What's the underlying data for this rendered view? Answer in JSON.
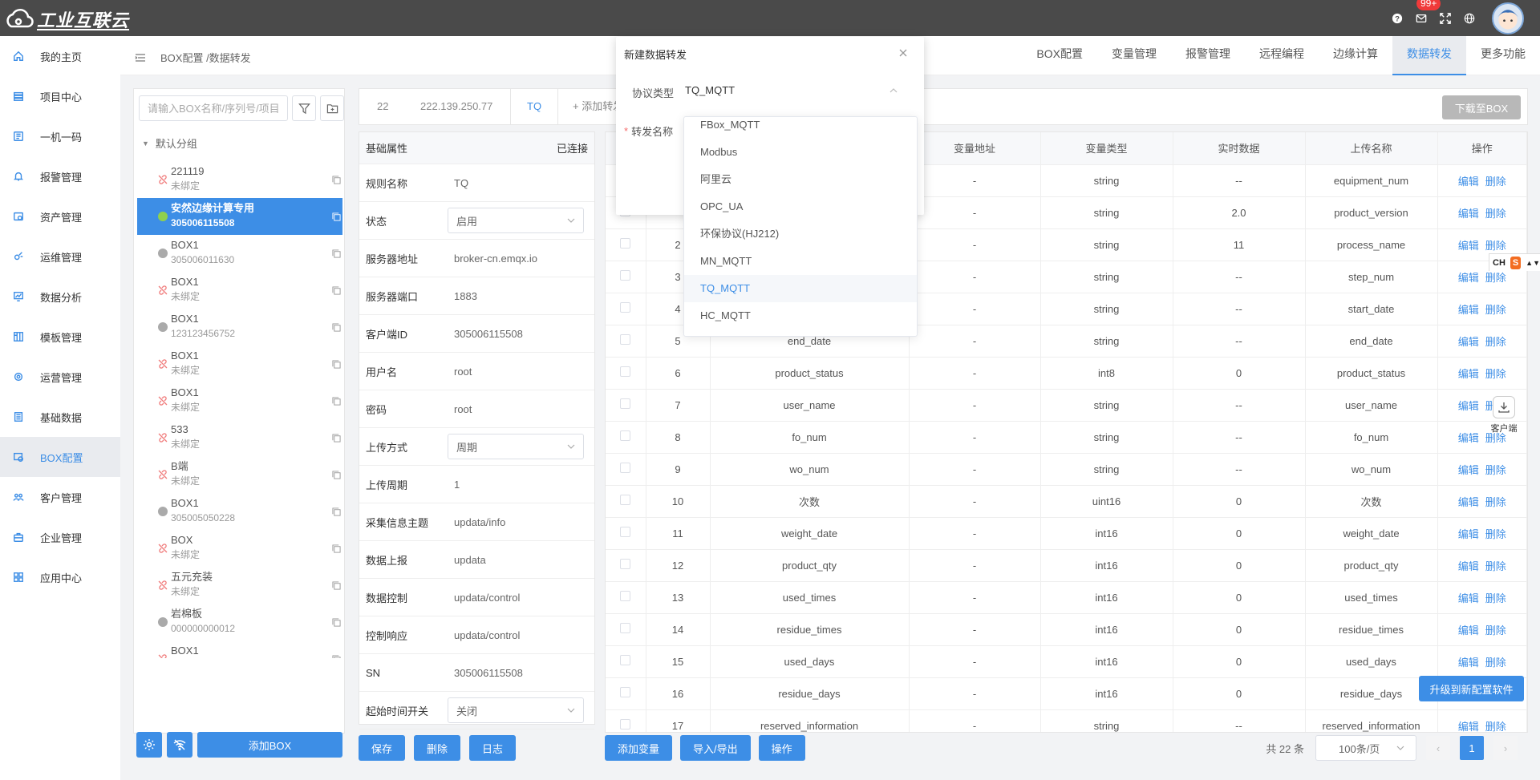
{
  "app": {
    "logo_text": "工业互联云",
    "badge": "99+"
  },
  "sidebar": {
    "items": [
      {
        "label": "我的主页",
        "icon": "home-icon"
      },
      {
        "label": "项目中心",
        "icon": "project-icon"
      },
      {
        "label": "一机一码",
        "icon": "qrcode-icon"
      },
      {
        "label": "报警管理",
        "icon": "bell-icon"
      },
      {
        "label": "资产管理",
        "icon": "asset-icon"
      },
      {
        "label": "运维管理",
        "icon": "tools-icon"
      },
      {
        "label": "数据分析",
        "icon": "chart-icon"
      },
      {
        "label": "模板管理",
        "icon": "template-icon"
      },
      {
        "label": "运营管理",
        "icon": "operate-icon"
      },
      {
        "label": "基础数据",
        "icon": "database-icon"
      },
      {
        "label": "BOX配置",
        "icon": "box-icon"
      },
      {
        "label": "客户管理",
        "icon": "users-icon"
      },
      {
        "label": "企业管理",
        "icon": "briefcase-icon"
      },
      {
        "label": "应用中心",
        "icon": "apps-icon"
      }
    ]
  },
  "header": {
    "breadcrumb": "BOX配置 /数据转发",
    "tabs": [
      "BOX配置",
      "变量管理",
      "报警管理",
      "远程编程",
      "边缘计算",
      "数据转发",
      "更多功能"
    ]
  },
  "boxlist": {
    "search_placeholder": "请输入BOX名称/序列号/项目",
    "group": "默认分组",
    "items": [
      {
        "name": "221119",
        "sub": "未绑定",
        "status": "unlink"
      },
      {
        "name": "安然边缘计算专用",
        "sub": "305006115508",
        "status": "online"
      },
      {
        "name": "BOX1",
        "sub": "305006011630",
        "status": "offline"
      },
      {
        "name": "BOX1",
        "sub": "未绑定",
        "status": "unlink"
      },
      {
        "name": "BOX1",
        "sub": "123123456752",
        "status": "offline"
      },
      {
        "name": "BOX1",
        "sub": "未绑定",
        "status": "unlink"
      },
      {
        "name": "BOX1",
        "sub": "未绑定",
        "status": "unlink"
      },
      {
        "name": "533",
        "sub": "未绑定",
        "status": "unlink"
      },
      {
        "name": "B端",
        "sub": "未绑定",
        "status": "unlink"
      },
      {
        "name": "BOX1",
        "sub": "305005050228",
        "status": "offline"
      },
      {
        "name": "BOX",
        "sub": "未绑定",
        "status": "unlink"
      },
      {
        "name": "五元充装",
        "sub": "未绑定",
        "status": "unlink"
      },
      {
        "name": "岩棉板",
        "sub": "000000000012",
        "status": "offline"
      },
      {
        "name": "BOX1",
        "sub": "未绑定",
        "status": "unlink"
      },
      {
        "name": "BOX1",
        "sub": "未绑定",
        "status": "unlink"
      },
      {
        "name": "BOX1",
        "sub": "",
        "status": "unlink"
      }
    ],
    "add_label": "添加BOX"
  },
  "fwd": {
    "tab_id": "22",
    "tab_ip": "222.139.250.77",
    "tab_active": "TQ",
    "tab_add": "+ 添加转发",
    "download_label": "下载至BOX"
  },
  "props": {
    "head": "基础属性",
    "connected": "已连接",
    "rows": [
      {
        "label": "规则名称",
        "value": "TQ"
      },
      {
        "label": "状态",
        "value": "启用",
        "select": true
      },
      {
        "label": "服务器地址",
        "value": "broker-cn.emqx.io"
      },
      {
        "label": "服务器端口",
        "value": "1883"
      },
      {
        "label": "客户端ID",
        "value": "305006115508"
      },
      {
        "label": "用户名",
        "value": "root"
      },
      {
        "label": "密码",
        "value": "root"
      },
      {
        "label": "上传方式",
        "value": "周期",
        "select": true
      },
      {
        "label": "上传周期",
        "value": "1"
      },
      {
        "label": "采集信息主题",
        "value": "updata/info"
      },
      {
        "label": "数据上报",
        "value": "updata"
      },
      {
        "label": "数据控制",
        "value": "updata/control"
      },
      {
        "label": "控制响应",
        "value": "updata/control"
      },
      {
        "label": "SN",
        "value": "305006115508"
      },
      {
        "label": "起始时间开关",
        "value": "关闭",
        "select": true
      }
    ],
    "save": "保存",
    "delete": "删除",
    "log": "日志"
  },
  "vtable": {
    "headers": [
      "变量地址",
      "变量类型",
      "实时数据",
      "上传名称",
      "操作"
    ],
    "edit": "编辑",
    "del": "删除",
    "rows": [
      {
        "no": "",
        "name": "",
        "addr": "-",
        "type": "string",
        "rt": "--",
        "up": "equipment_num"
      },
      {
        "no": "",
        "name": "",
        "addr": "-",
        "type": "string",
        "rt": "2.0",
        "up": "product_version"
      },
      {
        "no": "2",
        "name": "",
        "addr": "-",
        "type": "string",
        "rt": "11",
        "up": "process_name"
      },
      {
        "no": "3",
        "name": "",
        "addr": "-",
        "type": "string",
        "rt": "--",
        "up": "step_num"
      },
      {
        "no": "4",
        "name": "",
        "addr": "-",
        "type": "string",
        "rt": "--",
        "up": "start_date"
      },
      {
        "no": "5",
        "name": "end_date",
        "addr": "-",
        "type": "string",
        "rt": "--",
        "up": "end_date"
      },
      {
        "no": "6",
        "name": "product_status",
        "addr": "-",
        "type": "int8",
        "rt": "0",
        "up": "product_status"
      },
      {
        "no": "7",
        "name": "user_name",
        "addr": "-",
        "type": "string",
        "rt": "--",
        "up": "user_name"
      },
      {
        "no": "8",
        "name": "fo_num",
        "addr": "-",
        "type": "string",
        "rt": "--",
        "up": "fo_num"
      },
      {
        "no": "9",
        "name": "wo_num",
        "addr": "-",
        "type": "string",
        "rt": "--",
        "up": "wo_num"
      },
      {
        "no": "10",
        "name": "次数",
        "addr": "-",
        "type": "uint16",
        "rt": "0",
        "up": "次数"
      },
      {
        "no": "11",
        "name": "weight_date",
        "addr": "-",
        "type": "int16",
        "rt": "0",
        "up": "weight_date"
      },
      {
        "no": "12",
        "name": "product_qty",
        "addr": "-",
        "type": "int16",
        "rt": "0",
        "up": "product_qty"
      },
      {
        "no": "13",
        "name": "used_times",
        "addr": "-",
        "type": "int16",
        "rt": "0",
        "up": "used_times"
      },
      {
        "no": "14",
        "name": "residue_times",
        "addr": "-",
        "type": "int16",
        "rt": "0",
        "up": "residue_times"
      },
      {
        "no": "15",
        "name": "used_days",
        "addr": "-",
        "type": "int16",
        "rt": "0",
        "up": "used_days"
      },
      {
        "no": "16",
        "name": "residue_days",
        "addr": "-",
        "type": "int16",
        "rt": "0",
        "up": "residue_days"
      },
      {
        "no": "17",
        "name": "reserved_information",
        "addr": "-",
        "type": "string",
        "rt": "--",
        "up": "reserved_information"
      }
    ],
    "add_var": "添加变量",
    "import_export": "导入/导出",
    "operate": "操作",
    "total": "共 22 条",
    "page_size": "100条/页",
    "page": "1"
  },
  "floating": {
    "client": "客户端",
    "upgrade": "升级到新配置软件",
    "ime": "CH",
    "ime_logo": "S"
  },
  "modal": {
    "title": "新建数据转发",
    "protocol_label": "协议类型",
    "protocol_value": "TQ_MQTT",
    "name_label": "转发名称",
    "required": "*",
    "options": [
      "FBox_MQTT",
      "Modbus",
      "阿里云",
      "OPC_UA",
      "环保协议(HJ212)",
      "MN_MQTT",
      "TQ_MQTT",
      "HC_MQTT"
    ],
    "selected": "TQ_MQTT"
  },
  "colors": {
    "accent": "#3d8ee6",
    "topbar": "#4a4a4a",
    "danger": "#f03a3a"
  }
}
